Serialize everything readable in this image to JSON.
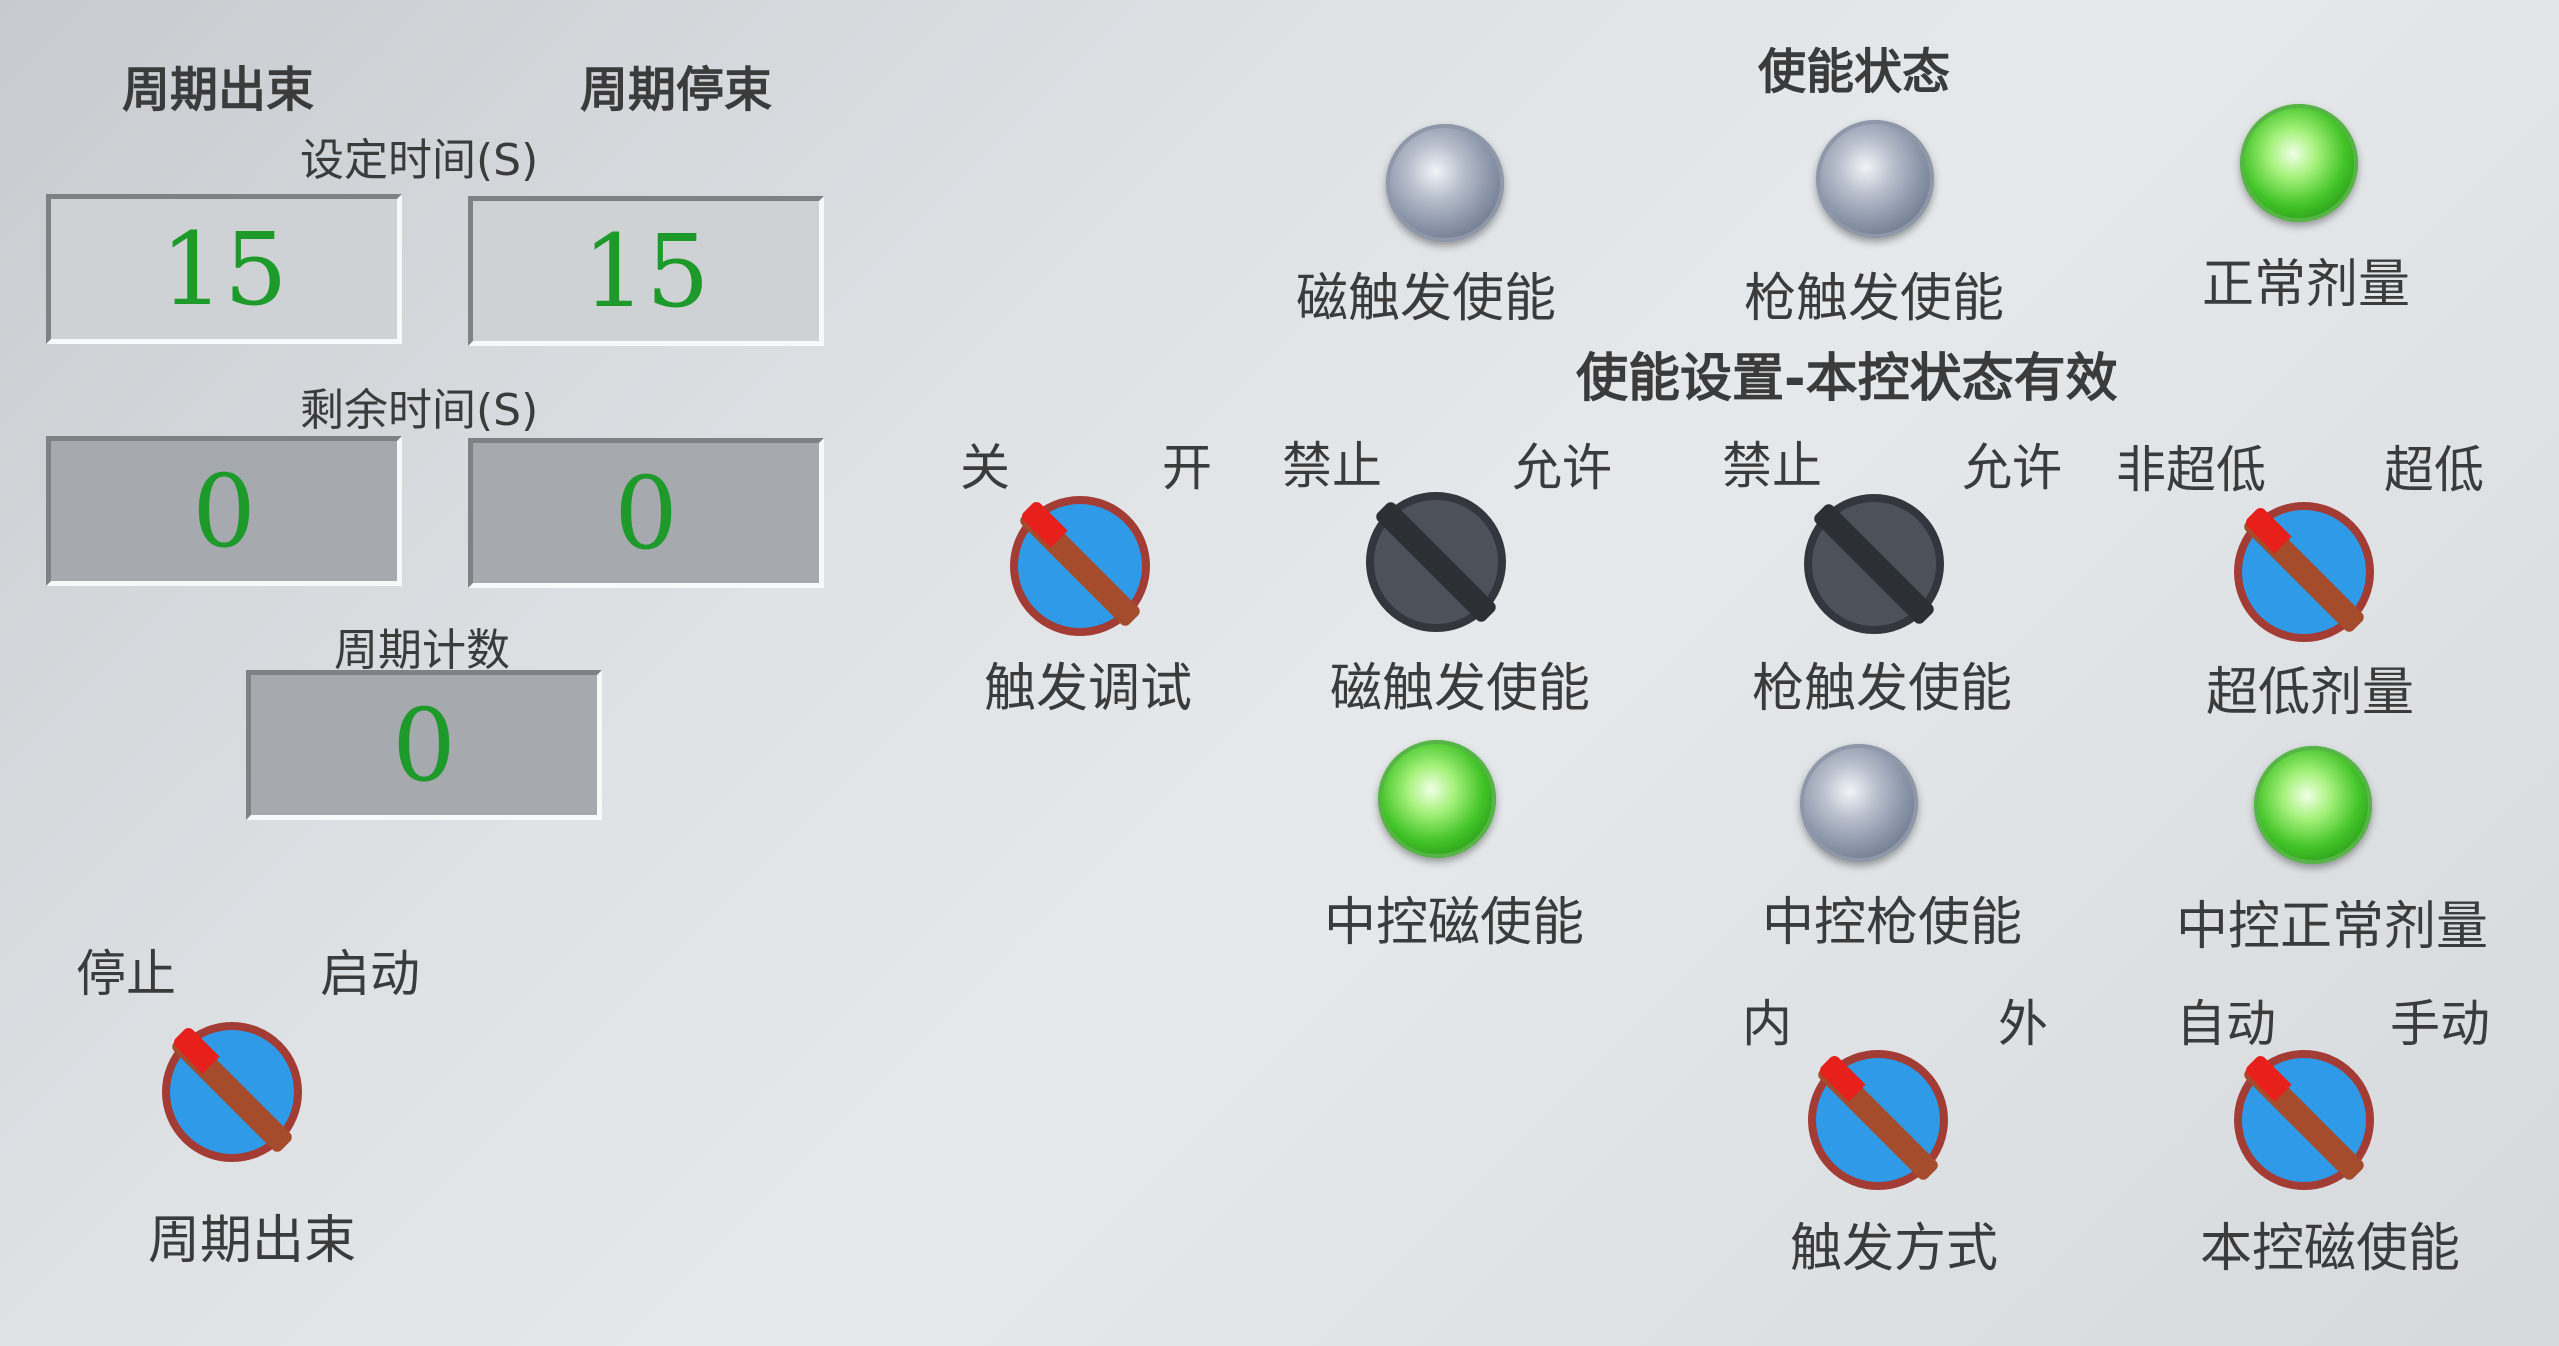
{
  "cycle": {
    "output_header": "周期出束",
    "stop_header": "周期停束",
    "set_time_label": "设定时间(S)",
    "set_output_value": "15",
    "set_stop_value": "15",
    "remain_time_label": "剩余时间(S)",
    "remain_output_value": "0",
    "remain_stop_value": "0",
    "count_label": "周期计数",
    "count_value": "0",
    "switch": {
      "left": "停止",
      "right": "启动",
      "name": "周期出束",
      "position": "停止"
    }
  },
  "enable_status": {
    "title": "使能状态",
    "lamps": [
      {
        "label": "磁触发使能",
        "state": "off"
      },
      {
        "label": "枪触发使能",
        "state": "off"
      },
      {
        "label": "正常剂量",
        "state": "on"
      }
    ]
  },
  "enable_settings": {
    "title": "使能设置-本控状态有效",
    "switches": [
      {
        "left": "关",
        "right": "开",
        "name": "触发调试",
        "color": "blue",
        "position": "关"
      },
      {
        "left": "禁止",
        "right": "允许",
        "name": "磁触发使能",
        "color": "grey",
        "position": "禁止"
      },
      {
        "left": "禁止",
        "right": "允许",
        "name": "枪触发使能",
        "color": "grey",
        "position": "禁止"
      },
      {
        "left": "非超低",
        "right": "超低",
        "name": "超低剂量",
        "color": "blue",
        "position": "非超低"
      }
    ],
    "central_lamps": [
      {
        "label": "中控磁使能",
        "state": "on"
      },
      {
        "label": "中控枪使能",
        "state": "off"
      },
      {
        "label": "中控正常剂量",
        "state": "on"
      }
    ],
    "bottom_switches": [
      {
        "left": "内",
        "right": "外",
        "name": "触发方式",
        "color": "blue",
        "position": "内"
      },
      {
        "left": "自动",
        "right": "手动",
        "name": "本控磁使能",
        "color": "blue",
        "position": "自动"
      }
    ]
  },
  "colors": {
    "lamp_on": "#43c428",
    "lamp_off": "#8d97ab",
    "knob_blue": "#2f9be8",
    "knob_grey": "#4d525a",
    "value_text": "#1d9a2a"
  }
}
